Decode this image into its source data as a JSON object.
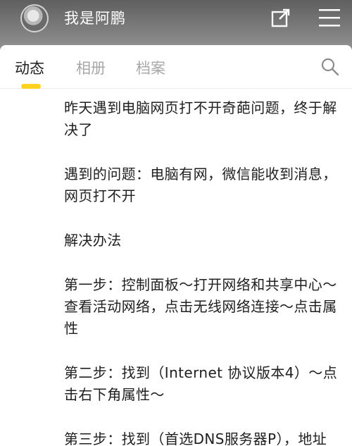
{
  "header": {
    "username": "我是阿鹏"
  },
  "tabs": [
    {
      "label": "动态",
      "active": true
    },
    {
      "label": "相册",
      "active": false
    },
    {
      "label": "档案",
      "active": false
    }
  ],
  "post": {
    "paragraphs": [
      "昨天遇到电脑网页打不开奇葩问题，终于解决了",
      "遇到的问题：电脑有网，微信能收到消息，网页打不开",
      "解决办法",
      "第一步：控制面板～打开网络和共享中心～查看活动网络，点击无线网络连接～点击属性",
      "第二步：找到（Internet 协议版本4）～点击右下角属性～",
      "第三步：找到（首选DNS服务器P），地址"
    ]
  },
  "colors": {
    "active_tab_indicator": "#ffd21f",
    "header_background": "#8d8d8d",
    "text": "#202020"
  },
  "icons": {
    "share": "share-icon",
    "menu": "menu-icon",
    "search": "search-icon",
    "avatar": "avatar"
  }
}
